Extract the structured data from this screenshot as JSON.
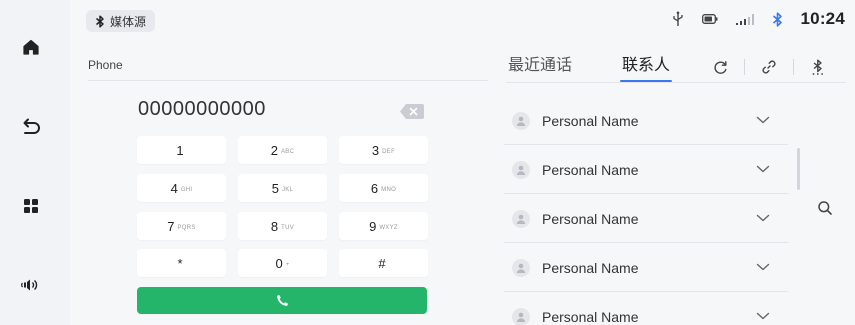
{
  "nav": {
    "items": [
      {
        "name": "home-icon"
      },
      {
        "name": "back-icon"
      },
      {
        "name": "apps-grid-icon"
      },
      {
        "name": "volume-icon"
      }
    ]
  },
  "status_bar": {
    "media_source_label": "媒体源",
    "time": "10:24",
    "icons": [
      "usb-icon",
      "battery-icon",
      "signal-icon",
      "bluetooth-icon"
    ]
  },
  "page": {
    "title": "Phone"
  },
  "tabs": [
    {
      "label": "最近通话",
      "active": false
    },
    {
      "label": "联系人",
      "active": true
    }
  ],
  "toolbar": {
    "icons": [
      "refresh-icon",
      "link-icon",
      "bluetooth-settings-icon"
    ]
  },
  "dialer": {
    "number": "00000000000",
    "keys": [
      {
        "digit": "1",
        "letters": ""
      },
      {
        "digit": "2",
        "letters": "ABC"
      },
      {
        "digit": "3",
        "letters": "DEF"
      },
      {
        "digit": "4",
        "letters": "GHI"
      },
      {
        "digit": "5",
        "letters": "JKL"
      },
      {
        "digit": "6",
        "letters": "MNO"
      },
      {
        "digit": "7",
        "letters": "PQRS"
      },
      {
        "digit": "8",
        "letters": "TUV"
      },
      {
        "digit": "9",
        "letters": "WXYZ"
      },
      {
        "digit": "*",
        "letters": ""
      },
      {
        "digit": "0",
        "letters": "+"
      },
      {
        "digit": "#",
        "letters": ""
      }
    ]
  },
  "contacts": [
    {
      "name": "Personal Name"
    },
    {
      "name": "Personal Name"
    },
    {
      "name": "Personal Name"
    },
    {
      "name": "Personal Name"
    },
    {
      "name": "Personal Name"
    }
  ],
  "colors": {
    "accent": "#3a78f2",
    "call": "#24b56b",
    "bluetooth": "#3a78f2"
  }
}
